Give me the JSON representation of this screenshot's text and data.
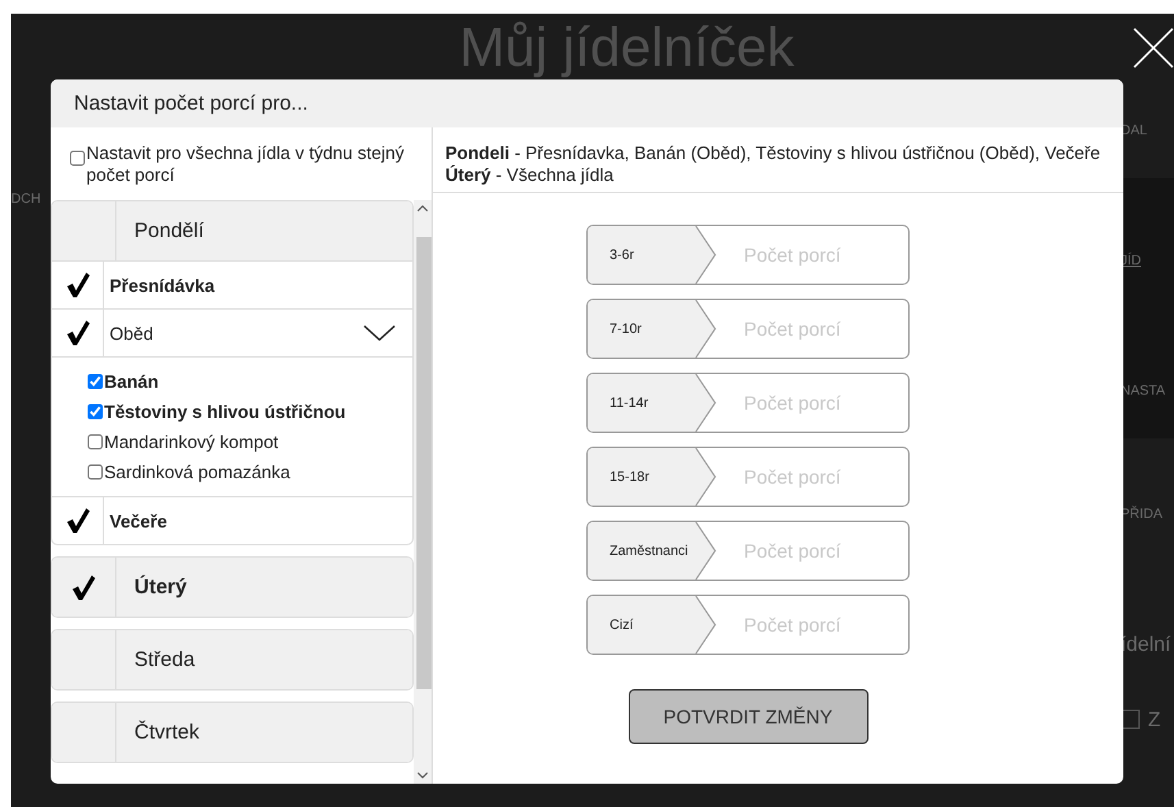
{
  "page": {
    "title": "Můj jídelníček",
    "side_left": [
      {
        "text": "DCH",
        "kind": "label"
      }
    ],
    "side_right": [
      {
        "text": "DAL",
        "kind": "label"
      },
      {
        "text": "JÍD",
        "kind": "link"
      },
      {
        "text": "NASTA",
        "kind": "button"
      },
      {
        "text": "PŘIDA",
        "kind": "button"
      },
      {
        "text": "ídelní",
        "kind": "heading"
      },
      {
        "text": "Z",
        "kind": "check",
        "checked": false
      }
    ]
  },
  "dialog": {
    "title": "Nastavit počet porcí pro...",
    "same_for_week": {
      "label": "Nastavit pro všechna jídla v týdnu stejný počet porcí",
      "checked": false
    },
    "days": [
      {
        "name": "Pondělí",
        "checked": false,
        "expanded": true,
        "meals": [
          {
            "name": "Přesnídávka",
            "checked": true,
            "expanded": false
          },
          {
            "name": "Oběd",
            "checked": true,
            "expanded": true,
            "foods": [
              {
                "name": "Banán",
                "checked": true
              },
              {
                "name": "Těstoviny s hlivou ústřičnou",
                "checked": true
              },
              {
                "name": "Mandarinkový kompot",
                "checked": false
              },
              {
                "name": "Sardinková pomazánka",
                "checked": false
              }
            ]
          },
          {
            "name": "Večeře",
            "checked": true,
            "expanded": false
          }
        ]
      },
      {
        "name": "Úterý",
        "checked": true
      },
      {
        "name": "Středa",
        "checked": false
      },
      {
        "name": "Čtvrtek",
        "checked": false
      }
    ],
    "summary": [
      "**Pondeli** - Přesnídavka, Banán (Oběd), Těstoviny s hlivou ústřičnou (Oběd), Večeře",
      "**Úterý** - Všechna jídla"
    ],
    "portions": [
      {
        "label": "3-6r",
        "placeholder": "Počet porcí"
      },
      {
        "label": "7-10r",
        "placeholder": "Počet porcí"
      },
      {
        "label": "11-14r",
        "placeholder": "Počet porcí"
      },
      {
        "label": "15-18r",
        "placeholder": "Počet porcí"
      },
      {
        "label": "Zaměstnanci",
        "placeholder": "Počet porcí"
      },
      {
        "label": "Cizí",
        "placeholder": "Počet porcí"
      }
    ],
    "confirm": "POTVRDIT ZMĚNY"
  }
}
